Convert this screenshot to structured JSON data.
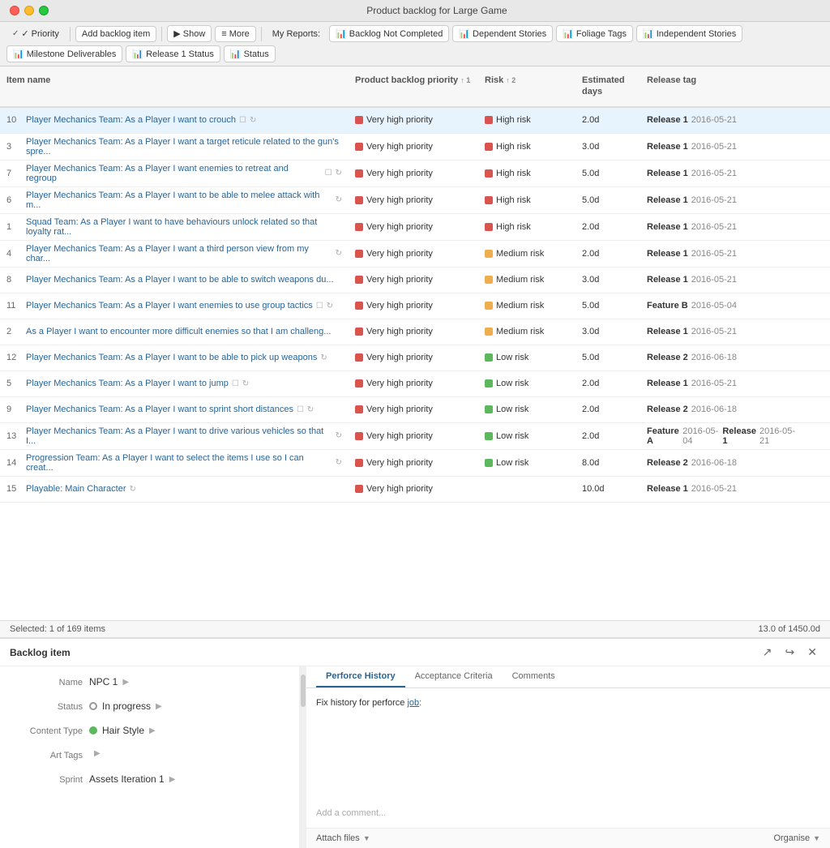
{
  "window": {
    "title": "Product backlog for Large Game"
  },
  "toolbar": {
    "priority_label": "✓ Priority",
    "add_backlog_label": "Add backlog item",
    "show_label": "Show",
    "more_label": "More",
    "my_reports_label": "My Reports:",
    "report_items": [
      "Backlog Not Completed",
      "Dependent Stories",
      "Foliage Tags",
      "Independent Stories",
      "Milestone Deliverables",
      "Release 1 Status",
      "Status"
    ]
  },
  "table": {
    "columns": [
      {
        "id": "name",
        "label": "Item name"
      },
      {
        "id": "priority",
        "label": "Product backlog priority",
        "sort": "↑ 1"
      },
      {
        "id": "risk",
        "label": "Risk",
        "sort": "↑ 2"
      },
      {
        "id": "days",
        "label": "Estimated days"
      },
      {
        "id": "release",
        "label": "Release tag"
      }
    ],
    "rows": [
      {
        "num": "10",
        "name": "Player Mechanics Team: As a Player I want to crouch",
        "has_checkbox": true,
        "has_refresh": true,
        "priority": "Very high priority",
        "priority_color": "red",
        "risk": "High risk",
        "risk_color": "red",
        "days": "2.0d",
        "release_bold": "Release 1",
        "release_date": "2016-05-21",
        "selected": true
      },
      {
        "num": "3",
        "name": "Player Mechanics Team: As a Player I want a target reticule related to the gun's spre...",
        "has_checkbox": false,
        "has_refresh": false,
        "priority": "Very high priority",
        "priority_color": "red",
        "risk": "High risk",
        "risk_color": "red",
        "days": "3.0d",
        "release_bold": "Release 1",
        "release_date": "2016-05-21"
      },
      {
        "num": "7",
        "name": "Player Mechanics Team: As a Player I want enemies to retreat and regroup",
        "has_checkbox": true,
        "has_refresh": true,
        "priority": "Very high priority",
        "priority_color": "red",
        "risk": "High risk",
        "risk_color": "red",
        "days": "5.0d",
        "release_bold": "Release 1",
        "release_date": "2016-05-21"
      },
      {
        "num": "6",
        "name": "Player Mechanics Team: As a Player I want to be able to melee attack with m...",
        "has_checkbox": false,
        "has_refresh": true,
        "priority": "Very high priority",
        "priority_color": "red",
        "risk": "High risk",
        "risk_color": "red",
        "days": "5.0d",
        "release_bold": "Release 1",
        "release_date": "2016-05-21"
      },
      {
        "num": "1",
        "name": "Squad Team: As a Player I want to have behaviours unlock related so that loyalty rat...",
        "has_checkbox": false,
        "has_refresh": false,
        "priority": "Very high priority",
        "priority_color": "red",
        "risk": "High risk",
        "risk_color": "red",
        "days": "2.0d",
        "release_bold": "Release 1",
        "release_date": "2016-05-21"
      },
      {
        "num": "4",
        "name": "Player Mechanics Team: As a Player I want a third person view from my char...",
        "has_checkbox": false,
        "has_refresh": true,
        "priority": "Very high priority",
        "priority_color": "red",
        "risk": "Medium risk",
        "risk_color": "yellow",
        "days": "2.0d",
        "release_bold": "Release 1",
        "release_date": "2016-05-21"
      },
      {
        "num": "8",
        "name": "Player Mechanics Team: As a Player I want to be able to switch weapons du...",
        "has_checkbox": false,
        "has_refresh": false,
        "priority": "Very high priority",
        "priority_color": "red",
        "risk": "Medium risk",
        "risk_color": "yellow",
        "days": "3.0d",
        "release_bold": "Release 1",
        "release_date": "2016-05-21"
      },
      {
        "num": "11",
        "name": "Player Mechanics Team: As a Player I want enemies to use group tactics",
        "has_checkbox": true,
        "has_refresh": true,
        "priority": "Very high priority",
        "priority_color": "red",
        "risk": "Medium risk",
        "risk_color": "yellow",
        "days": "5.0d",
        "release_bold": "Feature B",
        "release_date": "2016-05-04"
      },
      {
        "num": "2",
        "name": "As a Player I want to encounter more difficult enemies so that I am challeng...",
        "has_checkbox": false,
        "has_refresh": false,
        "priority": "Very high priority",
        "priority_color": "red",
        "risk": "Medium risk",
        "risk_color": "yellow",
        "days": "3.0d",
        "release_bold": "Release 1",
        "release_date": "2016-05-21"
      },
      {
        "num": "12",
        "name": "Player Mechanics Team: As a Player I want to be able to pick up weapons",
        "has_checkbox": false,
        "has_refresh": true,
        "priority": "Very high priority",
        "priority_color": "red",
        "risk": "Low risk",
        "risk_color": "green",
        "days": "5.0d",
        "release_bold": "Release 2",
        "release_date": "2016-06-18"
      },
      {
        "num": "5",
        "name": "Player Mechanics Team: As a Player I want to jump",
        "has_checkbox": true,
        "has_refresh": true,
        "priority": "Very high priority",
        "priority_color": "red",
        "risk": "Low risk",
        "risk_color": "green",
        "days": "2.0d",
        "release_bold": "Release 1",
        "release_date": "2016-05-21"
      },
      {
        "num": "9",
        "name": "Player Mechanics Team: As a Player I want to sprint short distances",
        "has_checkbox": true,
        "has_refresh": true,
        "priority": "Very high priority",
        "priority_color": "red",
        "risk": "Low risk",
        "risk_color": "green",
        "days": "2.0d",
        "release_bold": "Release 2",
        "release_date": "2016-06-18"
      },
      {
        "num": "13",
        "name": "Player Mechanics Team: As a Player I want to drive various vehicles so that I...",
        "has_checkbox": false,
        "has_refresh": true,
        "priority": "Very high priority",
        "priority_color": "red",
        "risk": "Low risk",
        "risk_color": "green",
        "days": "2.0d",
        "release_bold": "Feature A",
        "release_date": "2016-05-04",
        "release_bold2": "Release 1",
        "release_date2": "2016-05-21"
      },
      {
        "num": "14",
        "name": "Progression Team: As a Player I want to select the items I use so I can creat...",
        "has_checkbox": false,
        "has_refresh": true,
        "priority": "Very high priority",
        "priority_color": "red",
        "risk": "Low risk",
        "risk_color": "green",
        "days": "8.0d",
        "release_bold": "Release 2",
        "release_date": "2016-06-18"
      },
      {
        "num": "15",
        "name": "Playable: Main Character",
        "has_checkbox": false,
        "has_refresh": true,
        "priority": "Very high priority",
        "priority_color": "red",
        "risk": "",
        "risk_color": "",
        "days": "10.0d",
        "release_bold": "Release 1",
        "release_date": "2016-05-21"
      }
    ],
    "footer": {
      "selected": "Selected: 1 of 169 items",
      "total": "13.0 of 1450.0d"
    }
  },
  "bottom_panel": {
    "title": "Backlog item",
    "tabs": [
      "Perforce History",
      "Acceptance Criteria",
      "Comments"
    ],
    "active_tab": "Perforce History",
    "fields": [
      {
        "label": "Name",
        "value": "NPC 1",
        "type": "text"
      },
      {
        "label": "Status",
        "value": "In progress",
        "type": "status"
      },
      {
        "label": "Content Type",
        "value": "Hair Style",
        "type": "content"
      },
      {
        "label": "Art Tags",
        "value": "",
        "type": "arrow"
      },
      {
        "label": "Sprint",
        "value": "Assets Iteration 1",
        "type": "arrow"
      }
    ],
    "perforce_text": "Fix history for perforce ",
    "perforce_link": "job",
    "perforce_suffix": ":",
    "comment_placeholder": "Add a comment...",
    "attach_label": "Attach files",
    "organise_label": "Organise"
  }
}
